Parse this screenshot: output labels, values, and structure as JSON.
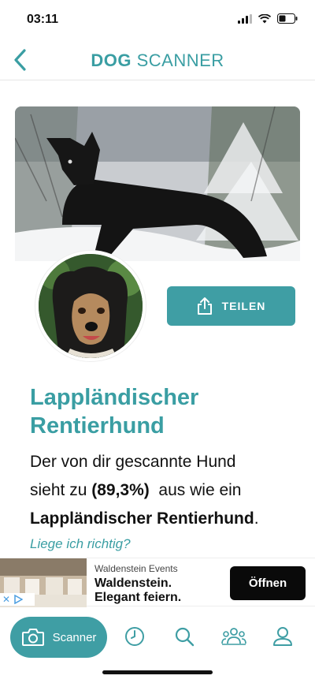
{
  "status": {
    "time": "03:11"
  },
  "nav": {
    "title_bold": "DOG",
    "title_rest": " SCANNER",
    "back_icon": "chevron-left-icon"
  },
  "share": {
    "label": "TEILEN"
  },
  "result": {
    "breed": "Lappländischer Rentierhund",
    "line1": "Der von dir gescannte Hund",
    "line2_prefix": "sieht zu ",
    "percentage": "(89,3%)",
    "line2_suffix": "  aus wie ein",
    "breed_bold": "Lappländischer Rentierhund",
    "period": "."
  },
  "feedback": {
    "link": "Liege ich richtig?"
  },
  "ad": {
    "advertiser": "Waldenstein Events",
    "headline": "Waldenstein. Elegant feiern.",
    "button": "Öffnen"
  },
  "tabbar": {
    "scanner_label": "Scanner",
    "items": [
      "camera-icon",
      "history-icon",
      "search-icon",
      "community-icon",
      "profile-icon"
    ]
  },
  "colors": {
    "accent": "#3f9ea4",
    "text": "#111111",
    "ad_button": "#0a0a0a"
  }
}
